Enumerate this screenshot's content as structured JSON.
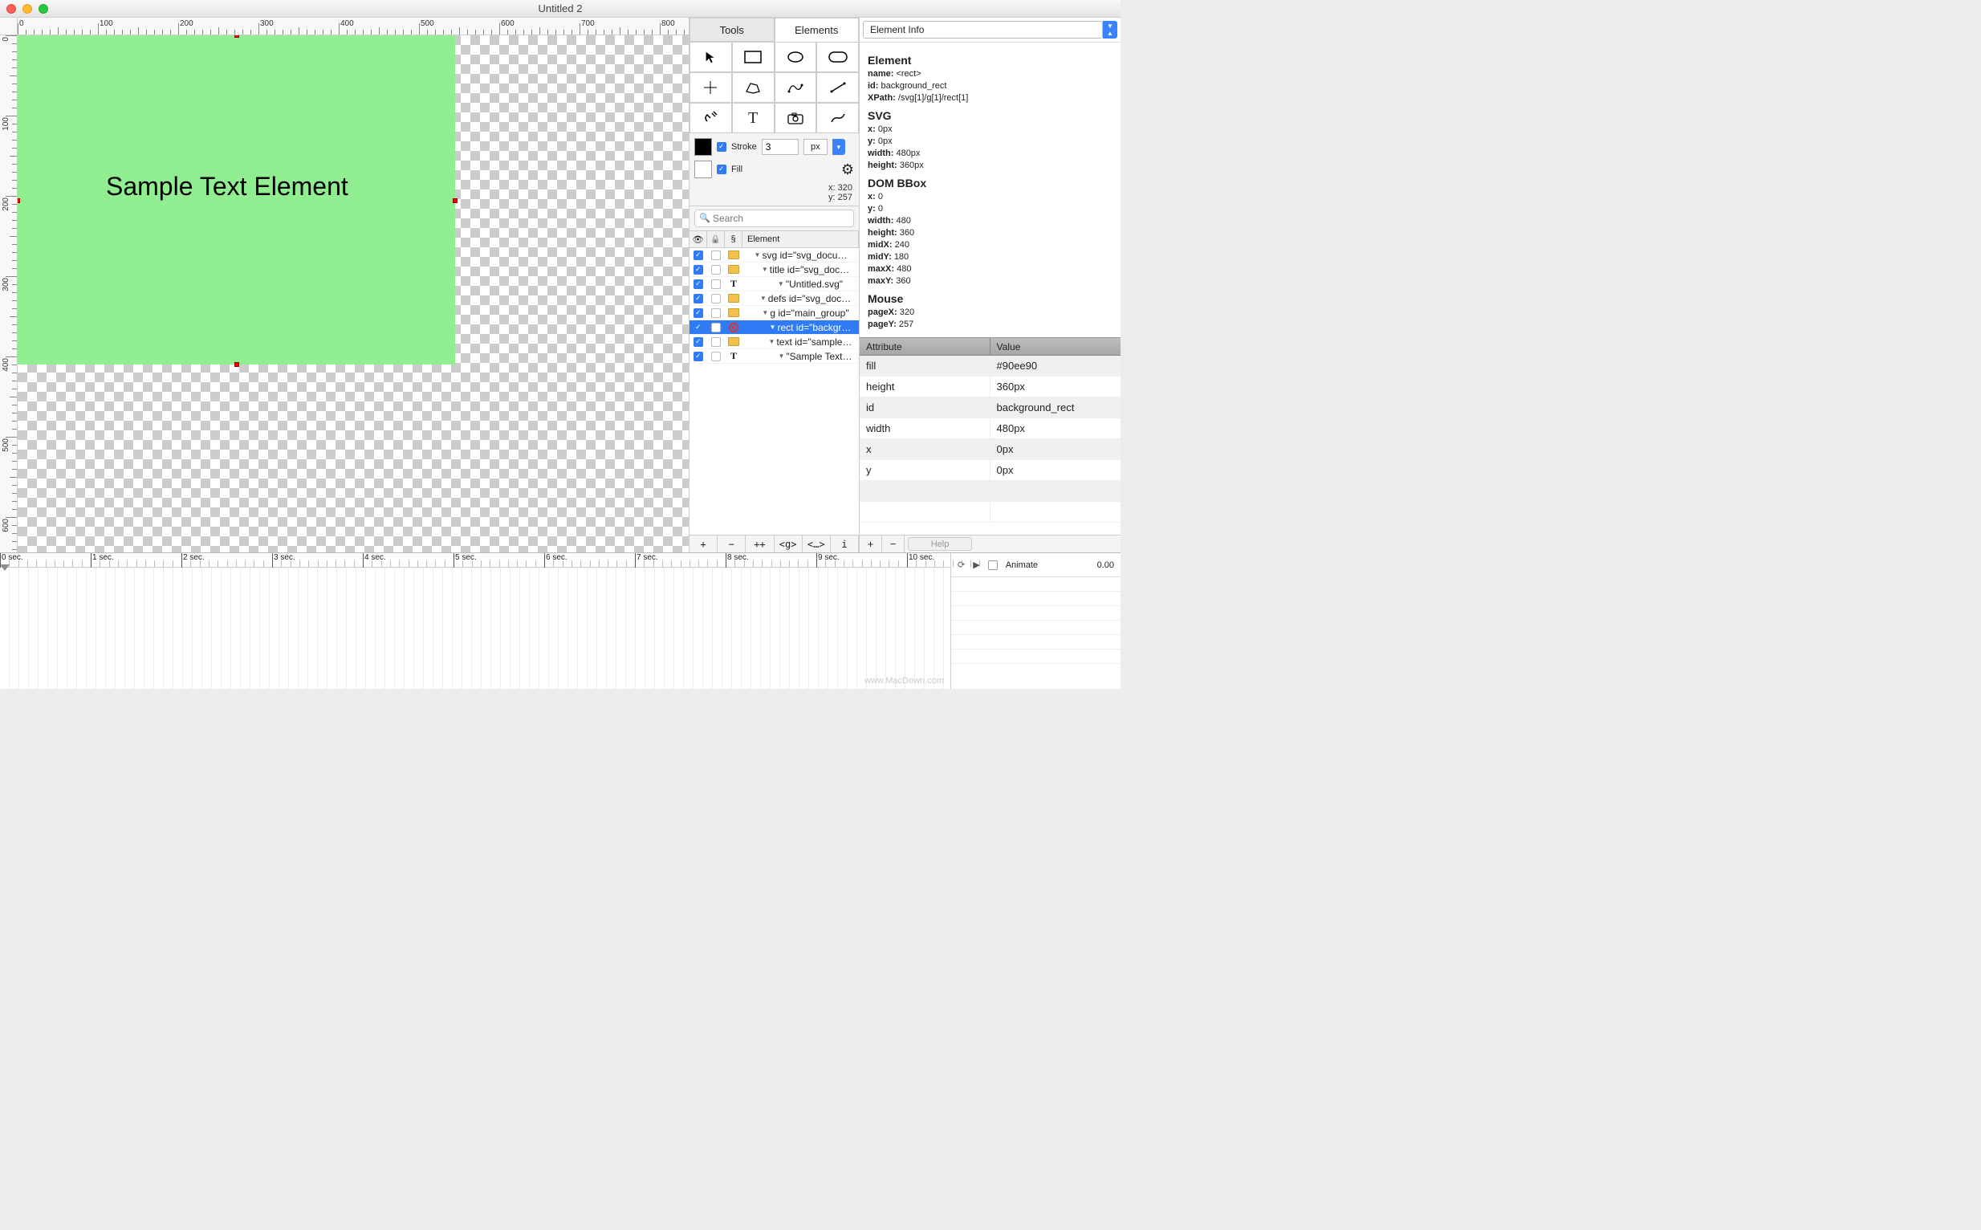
{
  "window": {
    "title": "Untitled 2"
  },
  "tabs": {
    "tools": "Tools",
    "elements": "Elements"
  },
  "toolIcons": [
    "arrow",
    "rect",
    "ellipse",
    "rounded",
    "crosshair",
    "polyline",
    "path",
    "line",
    "plug",
    "text",
    "camera",
    "curve"
  ],
  "stroke": {
    "enabled_label": "Stroke",
    "value": "3",
    "unit": "px"
  },
  "fill": {
    "enabled_label": "Fill"
  },
  "cursor": {
    "x_label": "x:",
    "x": "320",
    "y_label": "y:",
    "y": "257"
  },
  "search": {
    "placeholder": "Search"
  },
  "treeHeader": {
    "element": "Element",
    "section": "§"
  },
  "tree": [
    {
      "indent": 0,
      "icon": "folder",
      "label": "svg id=\"svg_docu…",
      "checked": true
    },
    {
      "indent": 1,
      "icon": "folder",
      "label": "title id=\"svg_doc…",
      "checked": true
    },
    {
      "indent": 2,
      "icon": "text",
      "label": "\"Untitled.svg\"",
      "checked": true
    },
    {
      "indent": 1,
      "icon": "folder",
      "label": "defs id=\"svg_doc…",
      "checked": true
    },
    {
      "indent": 1,
      "icon": "folder",
      "label": "g id=\"main_group\"",
      "checked": true
    },
    {
      "indent": 2,
      "icon": "target",
      "label": "rect id=\"backgr…",
      "checked": true,
      "selected": true
    },
    {
      "indent": 2,
      "icon": "folder",
      "label": "text id=\"sample…",
      "checked": true
    },
    {
      "indent": 3,
      "icon": "text",
      "label": "\"Sample Text…",
      "checked": true
    }
  ],
  "treeFooter": [
    "+",
    "−",
    "++",
    "<g>",
    "<…>",
    "i"
  ],
  "infoSelector": "Element Info",
  "info": {
    "element_h": "Element",
    "name_l": "name:",
    "name_v": "<rect>",
    "id_l": "id:",
    "id_v": "background_rect",
    "xpath_l": "XPath:",
    "xpath_v": "/svg[1]/g[1]/rect[1]",
    "svg_h": "SVG",
    "svg_x_l": "x:",
    "svg_x_v": "0px",
    "svg_y_l": "y:",
    "svg_y_v": "0px",
    "svg_w_l": "width:",
    "svg_w_v": "480px",
    "svg_h2_l": "height:",
    "svg_h2_v": "360px",
    "bbox_h": "DOM BBox",
    "bb_x_l": "x:",
    "bb_x_v": "0",
    "bb_y_l": "y:",
    "bb_y_v": "0",
    "bb_w_l": "width:",
    "bb_w_v": "480",
    "bb_h_l": "height:",
    "bb_h_v": "360",
    "midx_l": "midX:",
    "midx_v": "240",
    "midy_l": "midY:",
    "midy_v": "180",
    "maxx_l": "maxX:",
    "maxx_v": "480",
    "maxy_l": "maxY:",
    "maxy_v": "360",
    "mouse_h": "Mouse",
    "pagex_l": "pageX:",
    "pagex_v": "320",
    "pagey_l": "pageY:",
    "pagey_v": "257"
  },
  "attrHead": {
    "attr": "Attribute",
    "val": "Value"
  },
  "attrs": [
    {
      "a": "fill",
      "v": "#90ee90"
    },
    {
      "a": "height",
      "v": "360px"
    },
    {
      "a": "id",
      "v": "background_rect"
    },
    {
      "a": "width",
      "v": "480px"
    },
    {
      "a": "x",
      "v": "0px"
    },
    {
      "a": "y",
      "v": "0px"
    }
  ],
  "attrFooter": {
    "plus": "+",
    "minus": "−",
    "help": "Help"
  },
  "canvas": {
    "sampleText": "Sample Text Element",
    "rectFill": "#90ee90"
  },
  "timeline": {
    "labels": [
      "0 sec.",
      "1 sec.",
      "2 sec.",
      "3 sec.",
      "4 sec.",
      "5 sec.",
      "6 sec.",
      "7 sec.",
      "8 sec.",
      "9 sec.",
      "10 sec."
    ],
    "animate_label": "Animate",
    "time": "0.00"
  },
  "watermark": "www.MacDown.com"
}
